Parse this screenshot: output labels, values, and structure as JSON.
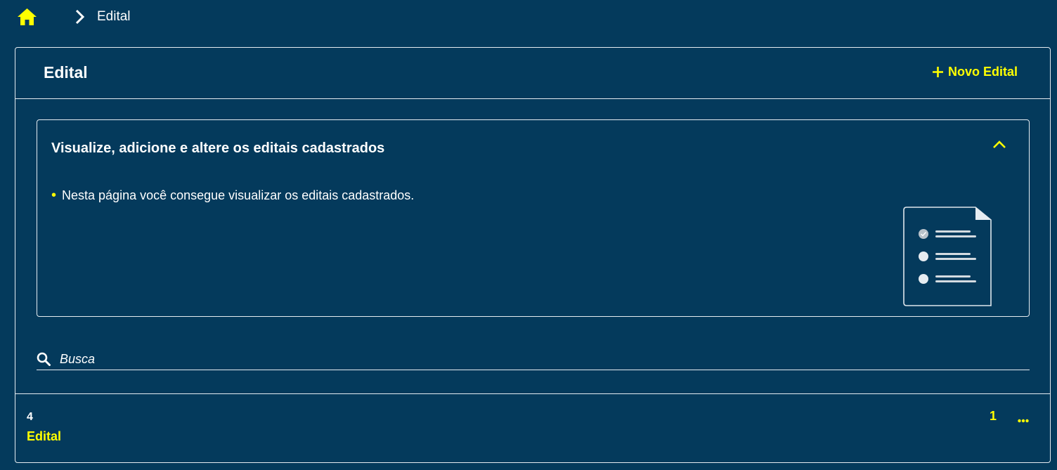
{
  "breadcrumb": {
    "home_icon": "home-icon",
    "separator_icon": "chevron-right-icon",
    "current": "Edital"
  },
  "header": {
    "title": "Edital",
    "new_button_label": "Novo Edital",
    "new_button_icon": "plus-icon"
  },
  "info_panel": {
    "title": "Visualize, adicione e altere os editais cadastrados",
    "items": [
      "Nesta página você consegue visualizar os editais cadastrados."
    ],
    "toggle_icon": "chevron-up-icon",
    "illustration": "document-checklist-icon"
  },
  "search": {
    "placeholder": "Busca",
    "icon": "search-icon"
  },
  "list": {
    "count": "4",
    "item_label": "Edital",
    "page": "1",
    "more_icon": "ellipsis-icon"
  },
  "colors": {
    "background": "#043a5c",
    "accent": "#ffff00",
    "text": "#ffffff",
    "border": "#e6ecf1"
  }
}
